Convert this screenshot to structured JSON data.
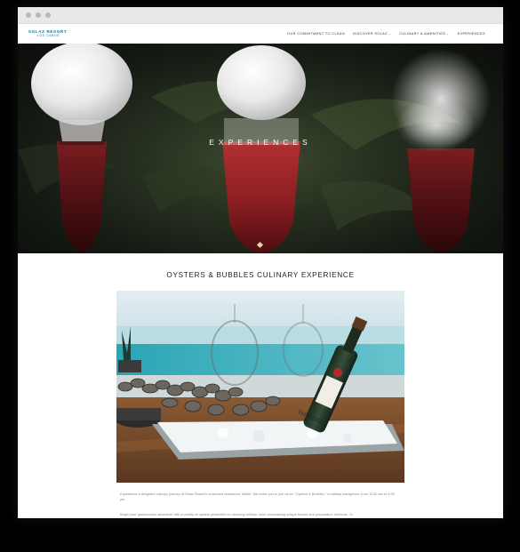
{
  "brand": {
    "name": "SOLAZ RESORT",
    "subtitle": "LOS CABOS",
    "accent": "#1f6f8b"
  },
  "nav": {
    "items": [
      {
        "label": "OUR COMMITMENT TO CLEAN",
        "dropdown": false
      },
      {
        "label": "DISCOVER SOLAZ",
        "dropdown": true
      },
      {
        "label": "CULINARY & AMENITIES",
        "dropdown": true
      },
      {
        "label": "EXPERIENCES",
        "dropdown": false
      }
    ]
  },
  "hero": {
    "title": "EXPERIENCES"
  },
  "article": {
    "title": "OYSTERS & BUBBLES CULINARY EXPERIENCE",
    "paragraph1": "Experience a delightful culinary journey at Solaz Resort's renowned restaurant, Mallet. We invite you to join us for \"Oysters & Bubbles,\" a midday indulgence, from 11:30 am to 4:00 pm.",
    "paragraph2": "Begin your gastronomic adventure with a variety of oysters presented on stunning trolleys, each showcasing unique flavors and preparation methods. To"
  },
  "photo": {
    "bottle_label": "TAITTINGER"
  }
}
